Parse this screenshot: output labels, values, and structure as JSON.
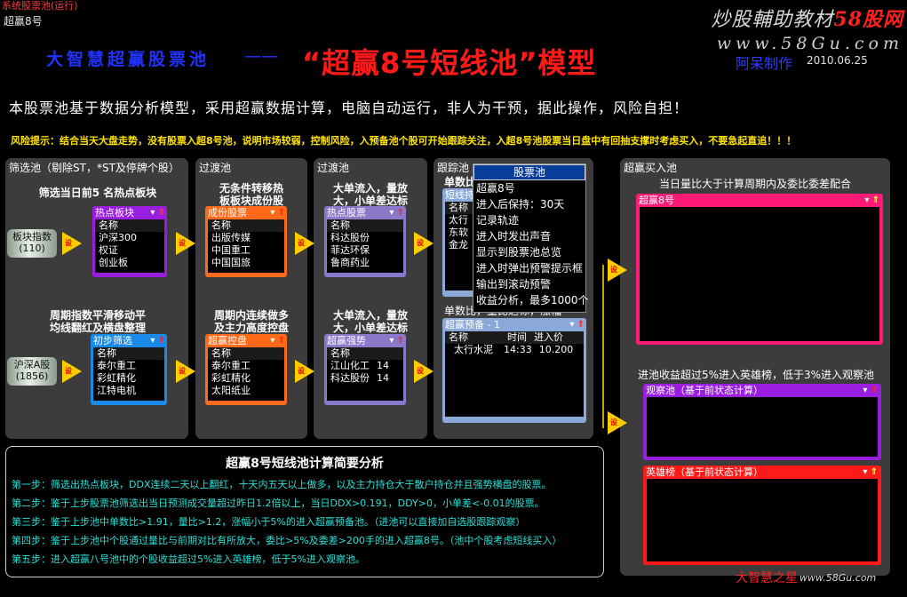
{
  "window": {
    "title": "系统股票池(运行)",
    "subtitle": "超赢8号"
  },
  "watermark": {
    "line1_prefix": "炒股輔助教材",
    "line1_brand": "58股网",
    "line2": "www.58Gu.com"
  },
  "header": {
    "left": "大智慧超赢股票池",
    "dash": "——",
    "title": "“超赢8号短线池”模型",
    "author": "阿呆制作",
    "date": "2010.06.25"
  },
  "intro": "本股票池基于数据分析模型，采用超赢数据计算，电脑自动运行，非人为干预，据此操作，风险自担！",
  "risk": "风险提示：结合当天大盘走势，没有股票入超8号池，说明市场较弱，控制风险，入预备池个股可开始跟踪关注，入超8号池股票当日盘中有回抽支撑时考虑买入，不要急起直追！！！",
  "panels": {
    "p1": "筛选池（剔除ST，*ST及停牌个股）",
    "p2": "过渡池",
    "p3": "过渡池",
    "p4": "跟踪池",
    "p5": "超赢买入池"
  },
  "labels": {
    "l1": "筛选当日前5 名热点板块",
    "l2": "周期指数平滑移动平\n均线翻红及横盘整理",
    "l3": "无条件转移热\n板板块成份股",
    "l4": "周期内连续做多\n及主力高度控盘",
    "l5": "大单流入，量放\n大，小单差达标",
    "l6": "大单流入，量放\n大，小单差达标",
    "l7": "单数比",
    "l8": "单数比，量比达标，涨幅<5%",
    "l9": "当日量比大于计算周期内及委比委差配合",
    "l10": "进池收益超过5%进入英雄榜，低于3%进入观察池"
  },
  "sources": {
    "s1": "板块指数",
    "s1n": "(110)",
    "s2": "沪深A股",
    "s2n": "(1856)"
  },
  "windows": {
    "hot_sector": {
      "title": "热点板块",
      "header": "名称",
      "rows": [
        "沪深300",
        "权证",
        "创业板"
      ]
    },
    "component": {
      "title": "成份股票",
      "header": "名称",
      "rows": [
        "出版传媒",
        "中国重工",
        "中国国旅"
      ]
    },
    "hot_stock": {
      "title": "热点股票",
      "header": "名称",
      "rows": [
        "科达股份",
        "菲达环保",
        "鲁商药业"
      ]
    },
    "initial": {
      "title": "初步筛选",
      "header": "名称",
      "rows": [
        "泰尔重工",
        "彩虹精化",
        "江特电机"
      ]
    },
    "control": {
      "title": "超赢控盘",
      "header": "名称",
      "rows": [
        "泰尔重工",
        "彩虹精化",
        "太阳纸业"
      ]
    },
    "strong": {
      "title": "超赢强势",
      "header": "名称",
      "rows": [
        [
          "江山化工",
          "14"
        ],
        [
          "科达股份",
          "14"
        ]
      ]
    },
    "track": {
      "title": "短线持",
      "header": "名称",
      "rows": [
        "太行",
        "东软",
        "金龙"
      ]
    },
    "prepare": {
      "title": "超赢预备 - 1",
      "headers": [
        "名称",
        "时间",
        "进入价"
      ],
      "rows": [
        [
          "太行水泥",
          "14:33",
          "10.200"
        ]
      ]
    },
    "chaoying8": {
      "title": "超赢8号"
    },
    "observe": {
      "title": "观察池（基于前状态计算）"
    },
    "hero": {
      "title": "英雄榜（基于前状态计算）"
    }
  },
  "popup": {
    "title": "股票池",
    "items": [
      "超赢8号",
      "进入后保持：30天",
      "记录轨迹",
      "进入时发出声音",
      "显示到股票池总览",
      "进入时弹出预警提示框",
      "输出到滚动预警",
      "收益分析，最多1000个"
    ]
  },
  "analysis": {
    "title": "超赢8号短线池计算简要分析",
    "steps": [
      "第一步：筛选出热点板块，DDX连续二天以上翻红，十天内五天以上做多，以及主力持仓大于散户持仓并且强势横盘的股票。",
      "第二步：鉴于上步股票池筛选出当日预测成交量超过昨日1.2倍以上，当日DDX>0.191，DDY>0，小单差<-0.01的股票。",
      "第三步：鉴于上步池中单数比>1.91，量比>1.2，涨幅小于5%的进入超赢预备池。（进池可以直接加自选股跟踪观察）",
      "第四步：鉴于上步池中个股通过量比与前期对比有所放大，委比>5%及委差>200手的进入超赢8号。（池中个股考虑短线买入）",
      "第五步：进入超赢八号池中的个股收益超过5%进入英雄榜，低于5%进入观察池。"
    ]
  },
  "footer": {
    "author": "大智慧之星",
    "url": "www.58Gu.com"
  },
  "colors": {
    "purple": "#9a1ee0",
    "orange": "#ff6a1a",
    "lavender": "#8a78c8",
    "blue": "#1a8ae8",
    "pink": "#ff1a78",
    "red": "#ff1a1a",
    "violet": "#9a1ee0",
    "arrow": "#ffcc00"
  }
}
